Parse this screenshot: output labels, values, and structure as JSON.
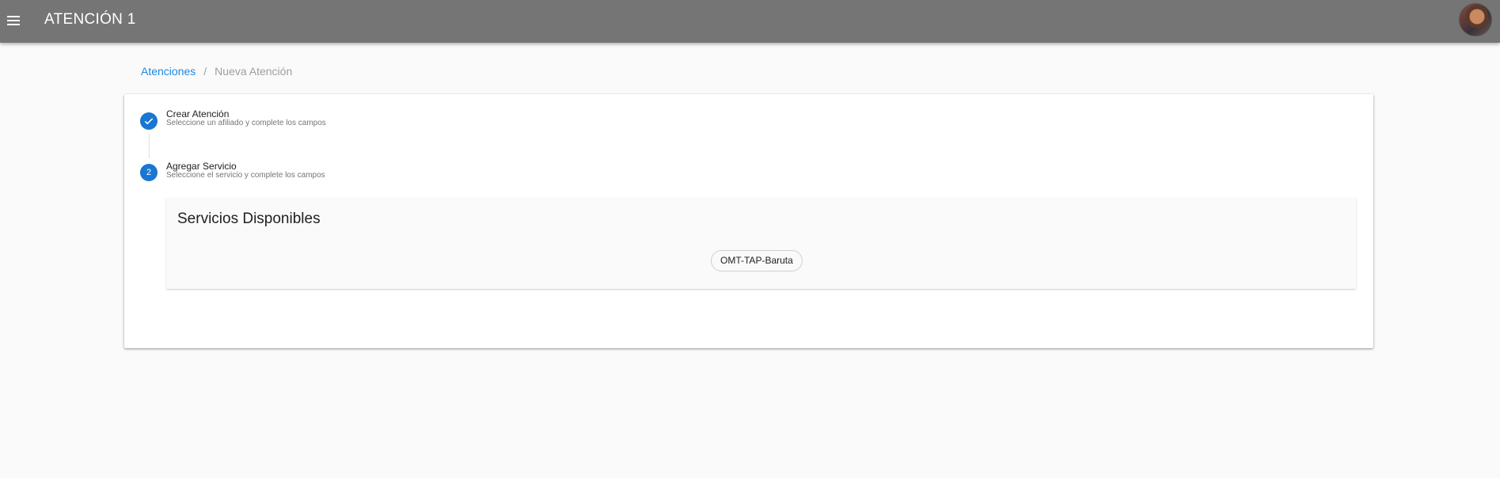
{
  "app": {
    "title": "ATENCIÓN 1",
    "menu_icon": "menu-icon",
    "avatar_icon": "user-avatar"
  },
  "breadcrumb": {
    "link": "Atenciones",
    "separator": "/",
    "current": "Nueva Atención"
  },
  "stepper": {
    "steps": [
      {
        "indicator": "check-icon",
        "title": "Crear Atención",
        "subtitle": "Seleccione un afiliado y complete los campos",
        "status": "completed"
      },
      {
        "indicator": "2",
        "title": "Agregar Servicio",
        "subtitle": "Seleccione el servicio y complete los campos",
        "status": "active"
      }
    ]
  },
  "services": {
    "title": "Servicios Disponibles",
    "items": [
      "OMT-TAP-Baruta"
    ]
  },
  "colors": {
    "topbar": "#757575",
    "accent": "#1976d2",
    "link": "#1e88e5",
    "background": "#fafafa"
  }
}
